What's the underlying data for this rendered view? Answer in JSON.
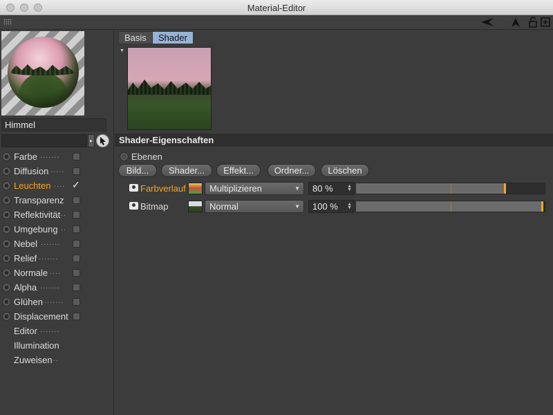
{
  "window": {
    "title": "Material-Editor"
  },
  "material": {
    "name": "Himmel"
  },
  "channels": [
    {
      "label": "Farbe",
      "dots": ".......",
      "checkbox": true,
      "checked": false,
      "active": false
    },
    {
      "label": "Diffusion",
      "dots": ".....",
      "checkbox": true,
      "checked": false,
      "active": false
    },
    {
      "label": "Leuchten",
      "dots": "....",
      "checkbox": true,
      "checked": true,
      "active": true
    },
    {
      "label": "Transparenz",
      "dots": "",
      "checkbox": true,
      "checked": false,
      "active": false
    },
    {
      "label": "Reflektivität",
      "dots": "..",
      "checkbox": true,
      "checked": false,
      "active": false
    },
    {
      "label": "Umgebung",
      "dots": "..",
      "checkbox": true,
      "checked": false,
      "active": false
    },
    {
      "label": "Nebel",
      "dots": ".......",
      "checkbox": true,
      "checked": false,
      "active": false
    },
    {
      "label": "Relief",
      "dots": ".......",
      "checkbox": true,
      "checked": false,
      "active": false
    },
    {
      "label": "Normale",
      "dots": "....",
      "checkbox": true,
      "checked": false,
      "active": false
    },
    {
      "label": "Alpha",
      "dots": ".......",
      "checkbox": true,
      "checked": false,
      "active": false
    },
    {
      "label": "Glühen",
      "dots": ".......",
      "checkbox": true,
      "checked": false,
      "active": false
    },
    {
      "label": "Displacement",
      "dots": "",
      "checkbox": true,
      "checked": false,
      "active": false
    },
    {
      "label": "Editor",
      "dots": ".......",
      "checkbox": false,
      "checked": false,
      "active": false
    },
    {
      "label": "Illumination",
      "dots": "",
      "checkbox": false,
      "checked": false,
      "active": false
    },
    {
      "label": "Zuweisen",
      "dots": "..",
      "checkbox": false,
      "checked": false,
      "active": false
    }
  ],
  "tabs": [
    {
      "label": "Basis",
      "active": false
    },
    {
      "label": "Shader",
      "active": true
    }
  ],
  "section": {
    "title": "Shader-Eigenschaften"
  },
  "layers_option": {
    "label": "Ebenen"
  },
  "buttons": {
    "bild": "Bild...",
    "shader": "Shader...",
    "effekt": "Effekt...",
    "ordner": "Ordner...",
    "loeschen": "Löschen"
  },
  "layers": [
    {
      "name": "Farbverlauf",
      "active": true,
      "thumb": "gradient",
      "mode": "Multiplizieren",
      "value_text": "80 %",
      "value": 0.8
    },
    {
      "name": "Bitmap",
      "active": false,
      "thumb": "bitmap",
      "mode": "Normal",
      "value_text": "100 %",
      "value": 1.0
    }
  ],
  "colors": {
    "accent": "#f5a623",
    "tab_active": "#96b3d6"
  }
}
